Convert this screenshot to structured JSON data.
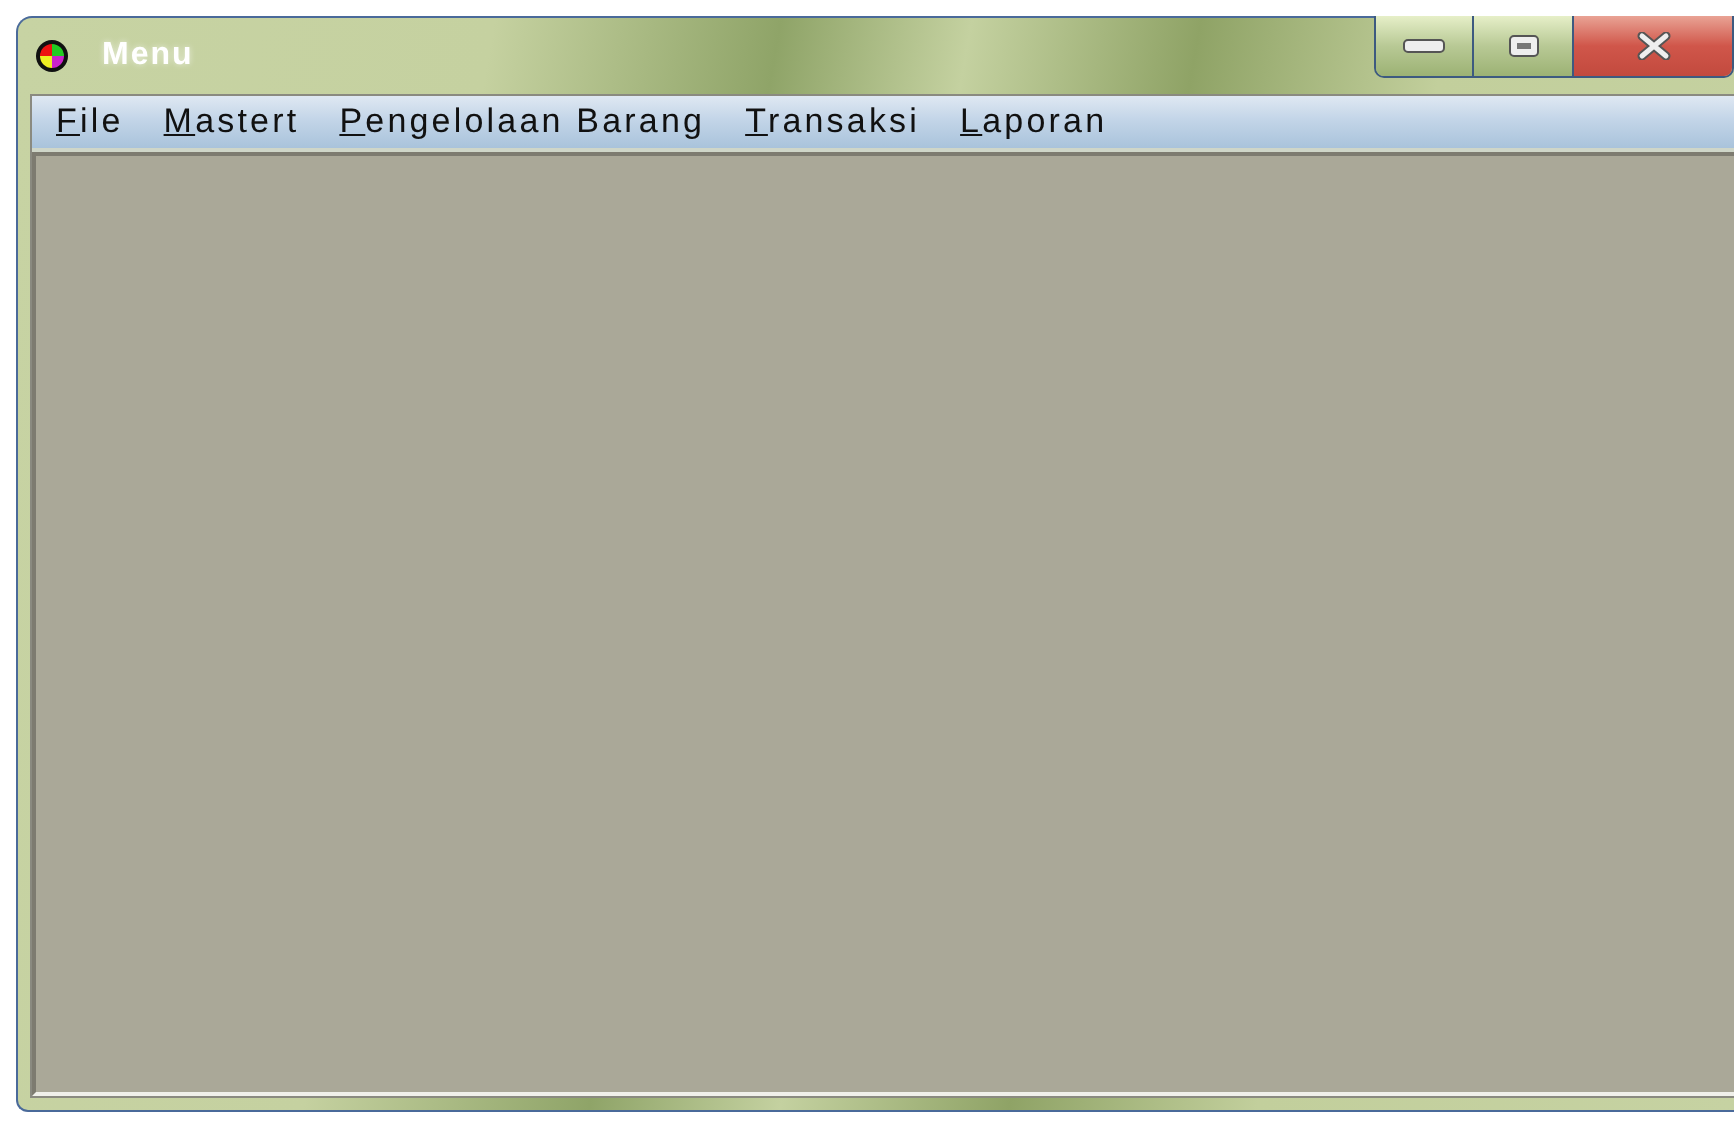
{
  "window": {
    "title": "Menu"
  },
  "menu": [
    {
      "label": "File"
    },
    {
      "label": "Mastert"
    },
    {
      "label": "Pengelolaan Barang"
    },
    {
      "label": "Transaksi"
    },
    {
      "label": "Laporan"
    }
  ]
}
